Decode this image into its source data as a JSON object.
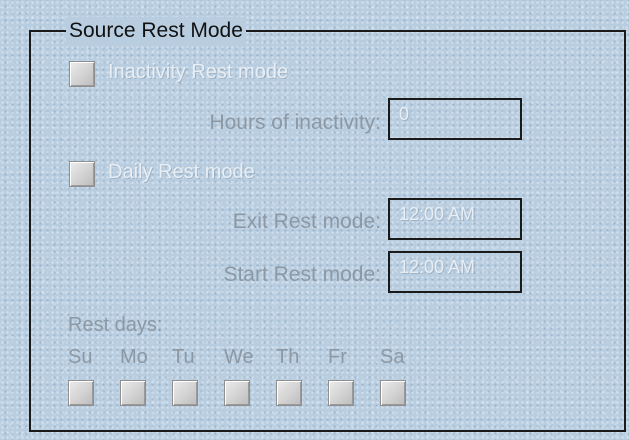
{
  "group": {
    "title": "Source Rest Mode"
  },
  "inactivity": {
    "label": "Inactivity Rest mode",
    "checked": false,
    "hours_label": "Hours of inactivity:",
    "hours_value": "0"
  },
  "daily": {
    "label": "Daily Rest mode",
    "checked": false,
    "exit_label": "Exit Rest mode:",
    "exit_value": "12:00 AM",
    "start_label": "Start Rest mode:",
    "start_value": "12:00 AM"
  },
  "rest_days": {
    "title": "Rest days:",
    "days": [
      {
        "label": "Su",
        "checked": false
      },
      {
        "label": "Mo",
        "checked": false
      },
      {
        "label": "Tu",
        "checked": false
      },
      {
        "label": "We",
        "checked": false
      },
      {
        "label": "Th",
        "checked": false
      },
      {
        "label": "Fr",
        "checked": false
      },
      {
        "label": "Sa",
        "checked": false
      }
    ]
  },
  "colors": {
    "background": "#b8cde0",
    "frame": "#1a1a1a",
    "disabled_text": "#8c98a4",
    "disabled_option_text": "#e8eef4"
  }
}
